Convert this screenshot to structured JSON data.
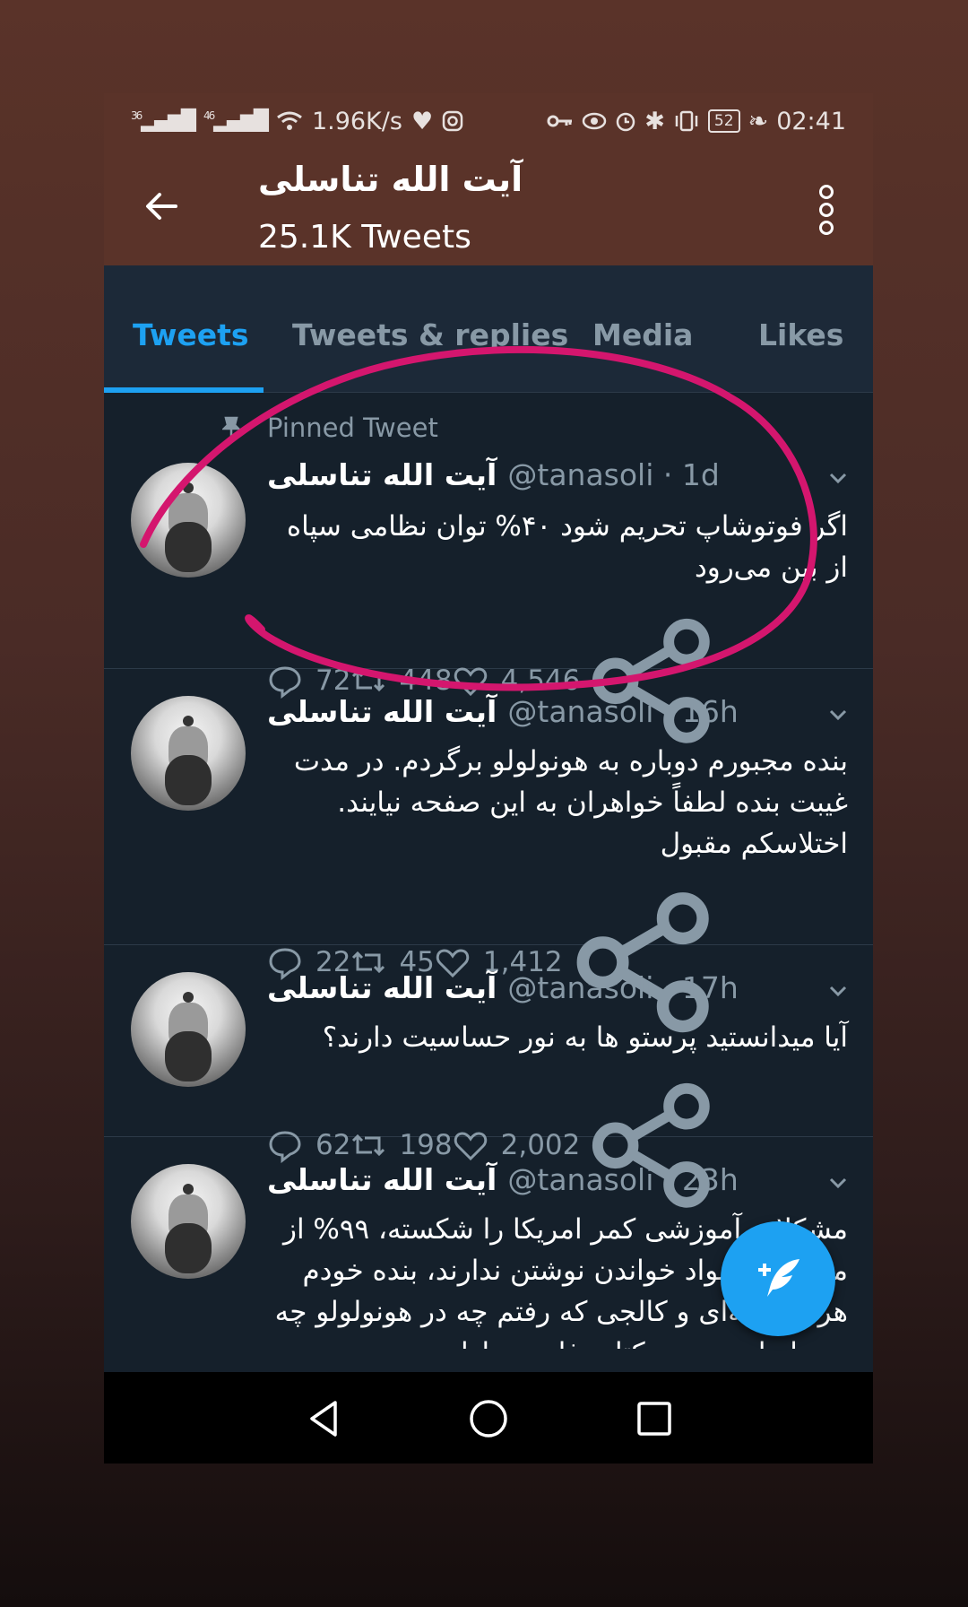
{
  "status_bar": {
    "network1": "36",
    "network2": "46",
    "speed": "1.96K/s",
    "battery": "52",
    "time": "02:41"
  },
  "header": {
    "title": "آیت الله تناسلی",
    "subtitle": "25.1K Tweets"
  },
  "tabs": [
    {
      "label": "Tweets",
      "active": true
    },
    {
      "label": "Tweets & replies",
      "active": false
    },
    {
      "label": "Media",
      "active": false
    },
    {
      "label": "Likes",
      "active": false
    }
  ],
  "pinned_label": "Pinned Tweet",
  "tweets": [
    {
      "name": "آیت الله تناسلی",
      "handle": "@tanasoli · 1d",
      "text": "اگر فوتوشاپ تحریم شود ۴۰% توان نظامی سپاه از بین می‌رود",
      "replies": "72",
      "retweets": "448",
      "likes": "4,546"
    },
    {
      "name": "آیت الله تناسلی",
      "handle": "@tanasoli · 16h",
      "text": "بنده مجبورم دوباره به هونولولو برگردم. در مدت غیبت بنده لطفاً خواهران به این صفحه نیایند. اختلاسکم مقبول",
      "replies": "22",
      "retweets": "45",
      "likes": "1,412"
    },
    {
      "name": "آیت الله تناسلی",
      "handle": "@tanasoli · 17h",
      "text": "آیا میدانستید پرستو ها به نور حساسیت دارند؟",
      "replies": "62",
      "retweets": "198",
      "likes": "2,002"
    },
    {
      "name": "آیت الله تناسلی",
      "handle": "@tanasoli · 23h",
      "text": "مشکلات آموزشی کمر امریکا را شکسته، ۹۹% از مردم آن سواد خواندن نوشتن ندارند، بنده خودم هر مدرسه‌ای و کالجی که رفتم چه در هونولولو چه در ماساچوست و کتاب فارسی اول"
    }
  ],
  "colors": {
    "accent": "#1da1f2",
    "background": "#15202b",
    "annotation": "#d4166e"
  }
}
